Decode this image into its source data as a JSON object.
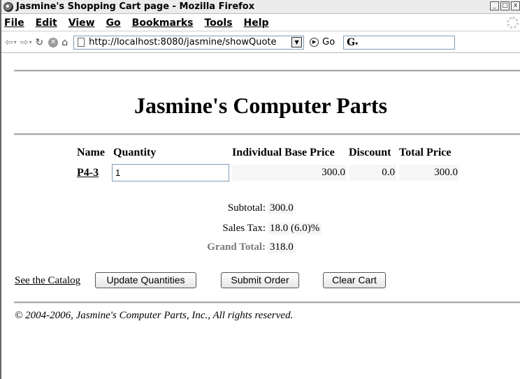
{
  "window": {
    "title": "Jasmine's Shopping Cart page - Mozilla Firefox",
    "controls": [
      "_",
      "□",
      "x"
    ]
  },
  "menu": {
    "items": [
      "File",
      "Edit",
      "View",
      "Go",
      "Bookmarks",
      "Tools",
      "Help"
    ]
  },
  "navbar": {
    "url": "http://localhost:8080/jasmine/showQuote",
    "go_label": "Go",
    "search_value": ""
  },
  "page": {
    "heading": "Jasmine's Computer Parts",
    "table": {
      "headers": {
        "name": "Name",
        "quantity": "Quantity",
        "individual_base_price": "Individual Base Price",
        "discount": "Discount",
        "total_price": "Total Price"
      },
      "rows": [
        {
          "name": "P4-3",
          "quantity": "1",
          "individual_base_price": "300.0",
          "discount": "0.0",
          "total_price": "300.0"
        }
      ]
    },
    "summary": {
      "subtotal_label": "Subtotal:",
      "subtotal_value": "300.0",
      "tax_label": "Sales Tax:",
      "tax_value": "18.0 (6.0)%",
      "grand_total_label": "Grand Total:",
      "grand_total_value": "318.0"
    },
    "actions": {
      "catalog_link": "See the Catalog",
      "update_button": "Update Quantities",
      "submit_button": "Submit Order",
      "clear_button": "Clear Cart"
    },
    "footer": "© 2004-2006, Jasmine's Computer Parts, Inc., All rights reserved."
  }
}
